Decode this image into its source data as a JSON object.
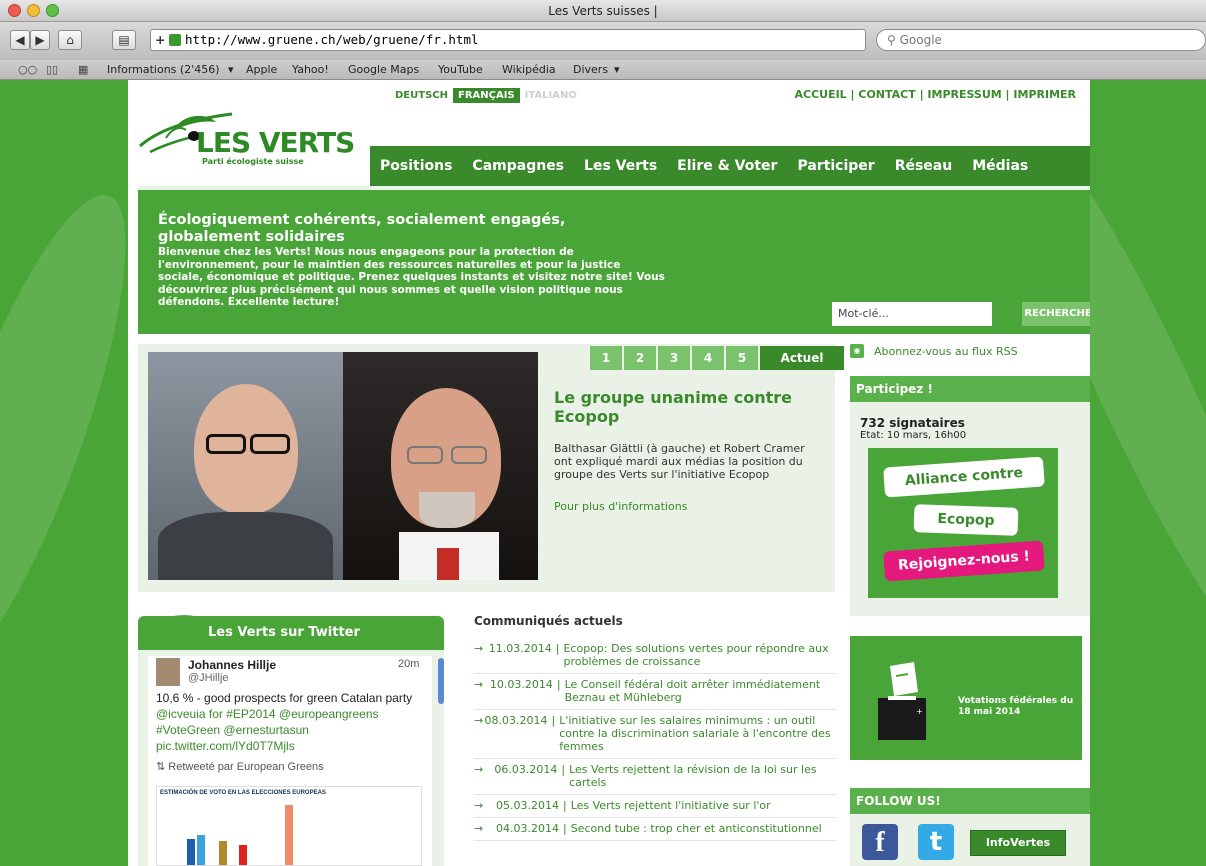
{
  "browser": {
    "window_title": "Les Verts suisses |",
    "url": "http://www.gruene.ch/web/gruene/fr.html",
    "search_placeholder": "Google",
    "reload_glyph": "c",
    "bookmarks": [
      "Informations (2'456)",
      "Apple",
      "Yahoo!",
      "Google Maps",
      "YouTube",
      "Wikipédia",
      "Divers"
    ]
  },
  "header": {
    "languages": [
      "DEUTSCH",
      "FRANÇAIS",
      "ITALIANO"
    ],
    "top_links": "ACCUEIL | CONTACT | IMPRESSUM | IMPRIMER",
    "logo_text": "LES VERTS",
    "logo_subtitle": "Parti écologiste suisse",
    "main_nav": [
      "Positions",
      "Campagnes",
      "Les Verts",
      "Elire & Voter",
      "Participer",
      "Réseau",
      "Médias"
    ]
  },
  "hero": {
    "title": "Écologiquement cohérents, socialement engagés, globalement solidaires",
    "text": "Bienvenue chez les Verts! Nous nous engageons pour la protection de l'environnement, pour le maintien des ressources naturelles et pour la justice sociale, économique et politique. Prenez quelques instants et visitez notre site! Vous découvrirez plus précisément qui nous sommes et quelle vision politique nous défendons. Excellente lecture!",
    "search_placeholder": "Mot-clé...",
    "search_button": "RECHERCHE"
  },
  "feature": {
    "tabs": [
      "1",
      "2",
      "3",
      "4",
      "5",
      "Actuel"
    ],
    "title": "Le groupe unanime contre Ecopop",
    "text": "Balthasar Glättli (à gauche) et Robert Cramer ont expliqué mardi aux médias la position du groupe des Verts sur l'initiative Ecopop",
    "link": "Pour plus d'informations"
  },
  "sidebar": {
    "rss": "Abonnez-vous au flux RSS",
    "participez_header": "Participez !",
    "signatures": "732 signataires",
    "etat": "Etat: 10 mars, 16h00",
    "alliance_lines": [
      "Alliance contre",
      "Ecopop",
      "Rejoignez-nous !"
    ],
    "votations": "Votations fédérales du 18 mai 2014",
    "follow_header": "FOLLOW US!",
    "infovertes": "InfoVertes"
  },
  "twitter": {
    "header": "Les Verts sur Twitter",
    "name": "Johannes Hillje",
    "handle": "@JHillje",
    "time": "20m",
    "text_line1": "10,6 % - good prospects for green Catalan party",
    "text_line2": "@icveuia for #EP2014 @europeangreens",
    "text_line3": "#VoteGreen @ernesturtasun",
    "text_line4": "pic.twitter.com/lYd0T7Mjls",
    "retweet": "Retweeté par European Greens",
    "chart_title": "ESTIMACIÓN DE VOTO EN LAS ELECCIONES EUROPEAS"
  },
  "communiques": {
    "header": "Communiqués actuels",
    "items": [
      {
        "date": "11.03.2014",
        "title": "Ecopop: Des solutions vertes pour répondre aux problèmes de croissance"
      },
      {
        "date": "10.03.2014",
        "title": "Le Conseil fédéral doit arrêter immédiatement Beznau et Mühleberg"
      },
      {
        "date": "08.03.2014",
        "title": "L'initiative sur les salaires minimums : un outil contre la discrimination salariale à l'encontre des femmes"
      },
      {
        "date": "06.03.2014",
        "title": "Les Verts rejettent la révision de la loi sur les cartels"
      },
      {
        "date": "05.03.2014",
        "title": "Les Verts rejettent l'initiative sur l'or"
      },
      {
        "date": "04.03.2014",
        "title": "Second tube : trop cher et anticonstitutionnel"
      }
    ]
  },
  "colors": {
    "brand_green": "#3a8a2c",
    "light_green": "#4aa538",
    "accent_pink": "#e4187d"
  }
}
